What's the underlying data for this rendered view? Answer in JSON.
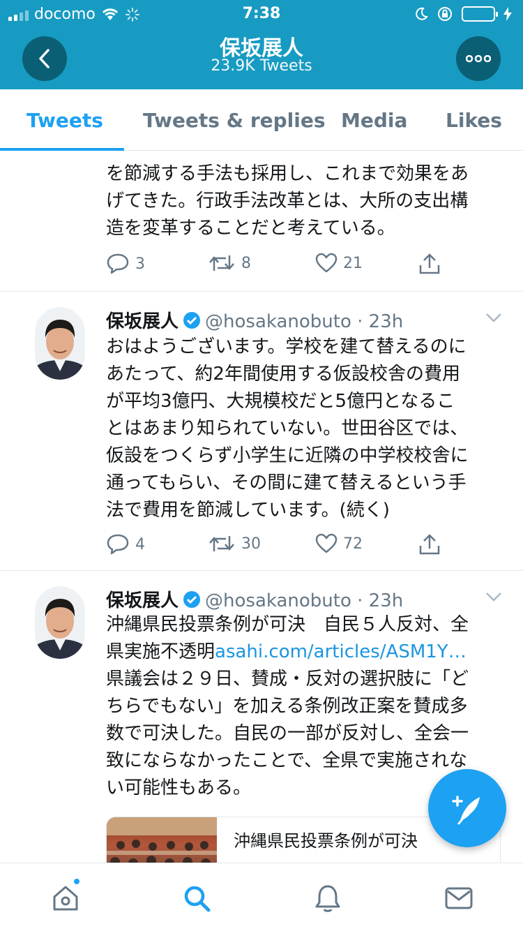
{
  "status_bar": {
    "carrier": "docomo",
    "time": "7:38"
  },
  "header": {
    "title": "保坂展人",
    "subtitle": "23.9K Tweets"
  },
  "tabs": [
    {
      "label": "Tweets",
      "active": true
    },
    {
      "label": "Tweets & replies",
      "active": false
    },
    {
      "label": "Media",
      "active": false
    },
    {
      "label": "Likes",
      "active": false
    }
  ],
  "tweets": [
    {
      "text_lines": [
        "を節減する手法も採用し、これまで効果をあ",
        "げてきた。行政手法改革とは、大所の支出構",
        "造を変革することだと考えている。"
      ],
      "replies": "3",
      "retweets": "8",
      "likes": "21"
    },
    {
      "name": "保坂展人",
      "handle": "@hosakanobuto · 23h",
      "text_lines": [
        "おはようございます。学校を建て替えるのに",
        "あたって、約2年間使用する仮設校舎の費用",
        "が平均3億円、大規模校だと5億円となるこ",
        "とはあまり知られていない。世田谷区では、",
        "仮設をつくらず小学生に近隣の中学校校舎に",
        "通ってもらい、その間に建て替えるという手",
        "法で費用を節減しています。(続く)"
      ],
      "replies": "4",
      "retweets": "30",
      "likes": "72"
    },
    {
      "name": "保坂展人",
      "handle": "@hosakanobuto · 23h",
      "line1": "沖縄県民投票条例が可決　自民５人反対、全",
      "line2_prefix": "県実施不透明",
      "line2_link": "asahi.com/articles/ASM1Y…",
      "text_lines": [
        "県議会は２９日、賛成・反対の選択肢に「ど",
        "ちらでもない」を加える条例改正案を賛成多",
        "数で可決した。自民の一部が反対し、全会一",
        "致にならなかったことで、全県で実施されな",
        "い可能性もある。"
      ],
      "card_title": "沖縄県民投票条例が可決"
    }
  ],
  "colors": {
    "header_bg": "#179bc2",
    "accent": "#1da1f2",
    "muted": "#657786"
  }
}
